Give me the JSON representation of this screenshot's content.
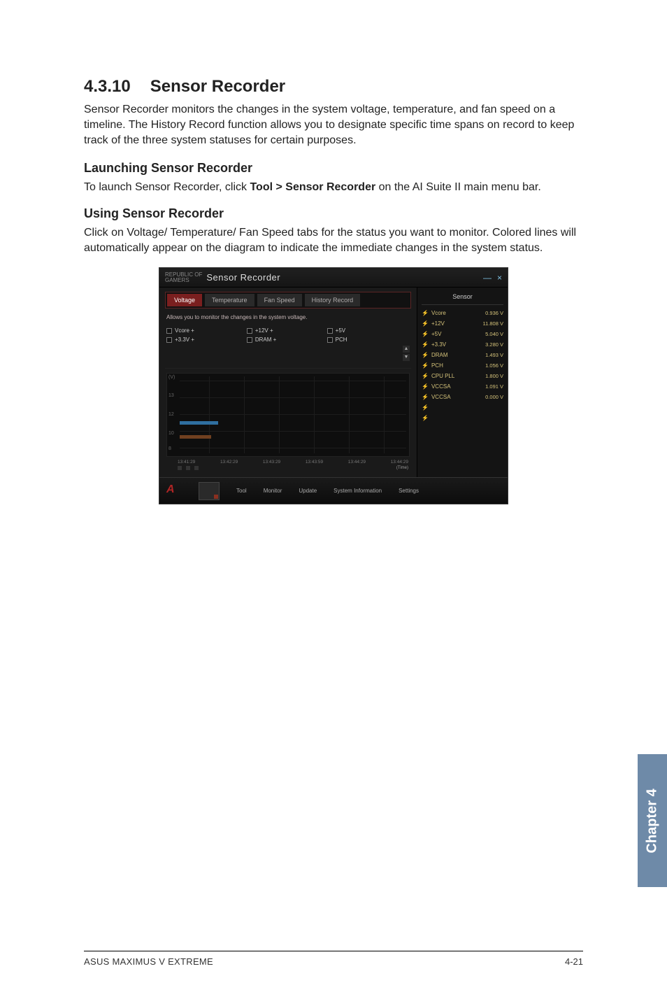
{
  "section": {
    "number": "4.3.10",
    "title": "Sensor Recorder"
  },
  "intro": "Sensor Recorder monitors the changes in the system voltage, temperature, and fan speed on a timeline. The History Record function allows you to designate specific time spans on record to keep track of the three system statuses for certain purposes.",
  "launch": {
    "heading": "Launching Sensor Recorder",
    "text_pre": "To launch Sensor Recorder, click ",
    "text_bold": "Tool > Sensor Recorder",
    "text_post": " on the AI Suite II main menu bar."
  },
  "using": {
    "heading": "Using Sensor Recorder",
    "text": "Click on Voltage/ Temperature/ Fan Speed tabs for the status you want to monitor. Colored lines will automatically appear on the diagram to indicate the immediate changes in the system status."
  },
  "shot": {
    "brand_top": "REPUBLIC OF",
    "brand_bot": "GAMERS",
    "title": "Sensor Recorder",
    "tabs": [
      "Voltage",
      "Temperature",
      "Fan Speed",
      "History Record"
    ],
    "hint": "Allows you to monitor the changes in the system voltage.",
    "checks": [
      "Vcore +",
      "+12V +",
      "+5V",
      "+3.3V +",
      "DRAM +",
      "PCH"
    ],
    "ylabels": [
      "(V)",
      "13",
      "12",
      "10",
      "8"
    ],
    "times": [
      "13:41:29",
      "13:42:29",
      "13:43:29",
      "13:43:59",
      "13:44:29",
      "13:44:29"
    ],
    "time_tag": "(Time)",
    "sensor_header": "Sensor",
    "sensors": [
      {
        "name": "Vcore",
        "value": "0.936 V"
      },
      {
        "name": "+12V",
        "value": "11.808 V"
      },
      {
        "name": "+5V",
        "value": "5.040 V"
      },
      {
        "name": "+3.3V",
        "value": "3.280 V"
      },
      {
        "name": "DRAM",
        "value": "1.493 V"
      },
      {
        "name": "PCH",
        "value": "1.056 V"
      },
      {
        "name": "CPU PLL",
        "value": "1.800 V"
      },
      {
        "name": "VCCSA",
        "value": "1.091 V"
      },
      {
        "name": "VCCSA",
        "value": "0.000 V"
      }
    ],
    "sensor_dim": [
      {
        "name": "",
        "value": ""
      },
      {
        "name": "",
        "value": ""
      }
    ],
    "bottom": [
      "Tool",
      "Monitor",
      "Update",
      "System Information",
      "Settings"
    ]
  },
  "chapter_tab": "Chapter 4",
  "footer": {
    "product": "ASUS MAXIMUS V EXTREME",
    "page": "4-21"
  }
}
